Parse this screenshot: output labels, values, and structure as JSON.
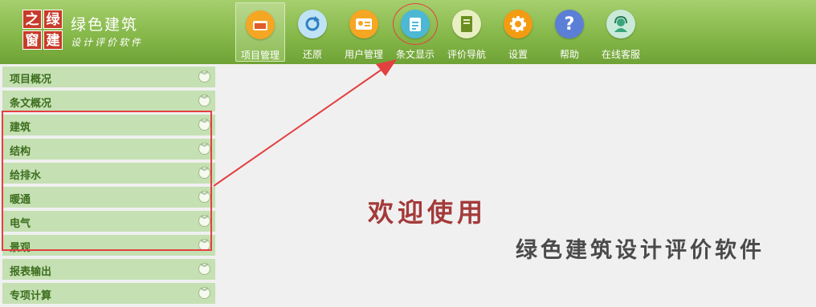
{
  "brand": {
    "logo_chars": [
      "之",
      "绿",
      "窗",
      "建"
    ],
    "logo_color": "#c83a2a",
    "title": "绿色建筑",
    "subtitle": "设计评价软件"
  },
  "toolbar": [
    {
      "label": "项目管理",
      "icon": "folder-icon",
      "color": "#f5a623",
      "active": true
    },
    {
      "label": "还原",
      "icon": "refresh-icon",
      "color": "#4da3d9"
    },
    {
      "label": "用户管理",
      "icon": "user-card-icon",
      "color": "#f5a623"
    },
    {
      "label": "条文显示",
      "icon": "notepad-icon",
      "color": "#4db8d4"
    },
    {
      "label": "评价导航",
      "icon": "book-icon",
      "color": "#6b8e23"
    },
    {
      "label": "设置",
      "icon": "gear-icon",
      "color": "#f39c12"
    },
    {
      "label": "帮助",
      "icon": "help-icon",
      "color": "#5b7fd6"
    },
    {
      "label": "在线客服",
      "icon": "support-icon",
      "color": "#3aa57a"
    }
  ],
  "sidebar": {
    "items": [
      {
        "label": "项目概况"
      },
      {
        "label": "条文概况"
      },
      {
        "label": "建筑"
      },
      {
        "label": "结构"
      },
      {
        "label": "给排水"
      },
      {
        "label": "暖通"
      },
      {
        "label": "电气"
      },
      {
        "label": "景观"
      },
      {
        "label": "报表输出"
      },
      {
        "label": "专项计算"
      }
    ]
  },
  "main": {
    "welcome": "欢迎使用",
    "app_name": "绿色建筑设计评价软件"
  },
  "colors": {
    "header_green": "#86b84a",
    "sidebar_item": "#c5e0b3",
    "annotation_red": "#e34040"
  }
}
